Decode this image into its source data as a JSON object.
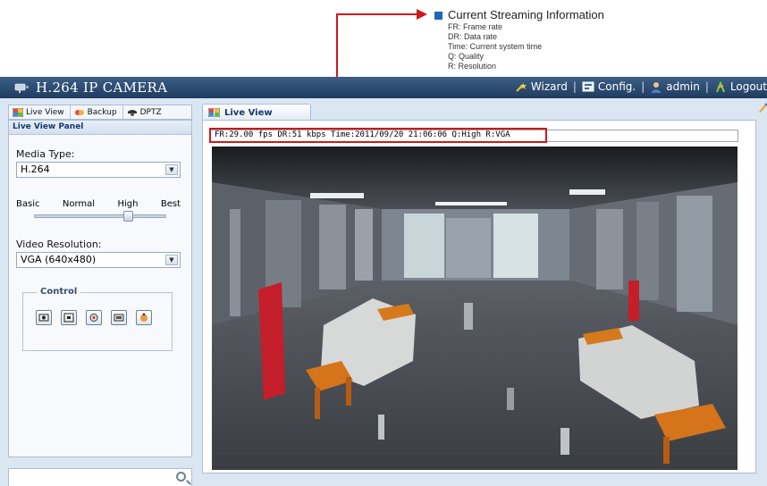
{
  "annotation": {
    "title": "Current Streaming Information",
    "lines": [
      "FR: Frame rate",
      "DR: Data rate",
      "Time: Current system time",
      "Q: Quality",
      "R: Resolution"
    ]
  },
  "window": {
    "title": "H.264 IP CAMERA",
    "links": {
      "wizard": "Wizard",
      "config": "Config.",
      "user": "admin",
      "logout": "Logout"
    }
  },
  "left_tabs": [
    "Live View",
    "Backup",
    "DPTZ"
  ],
  "panel": {
    "title": "Live View Panel",
    "media_type_label": "Media Type:",
    "media_type_value": "H.264",
    "quality_labels": [
      "Basic",
      "Normal",
      "High",
      "Best"
    ],
    "quality_level": "High",
    "resolution_label": "Video Resolution:",
    "resolution_value": "VGA (640x480)",
    "control_legend": "Control"
  },
  "view": {
    "tab_label": "Live View",
    "info_text": "FR:29.00 fps  DR:51 kbps Time:2011/09/20 21:06:06 Q:High R:VGA"
  },
  "search": {
    "placeholder": ""
  },
  "icons": {
    "app": "camera-icon",
    "wizard": "wizard-icon",
    "config": "config-icon",
    "user": "user-icon",
    "logout": "logout-icon",
    "live": "live-view-icon",
    "backup": "backup-icon",
    "dptz": "dptz-icon",
    "controls": [
      "snapshot-icon",
      "fullscreen-icon",
      "audio-icon",
      "record-icon",
      "ptz-icon"
    ]
  },
  "colors": {
    "highlight": "#d01818",
    "titlebar": "#2b4a70",
    "annotation_marker": "#1d66b8"
  }
}
